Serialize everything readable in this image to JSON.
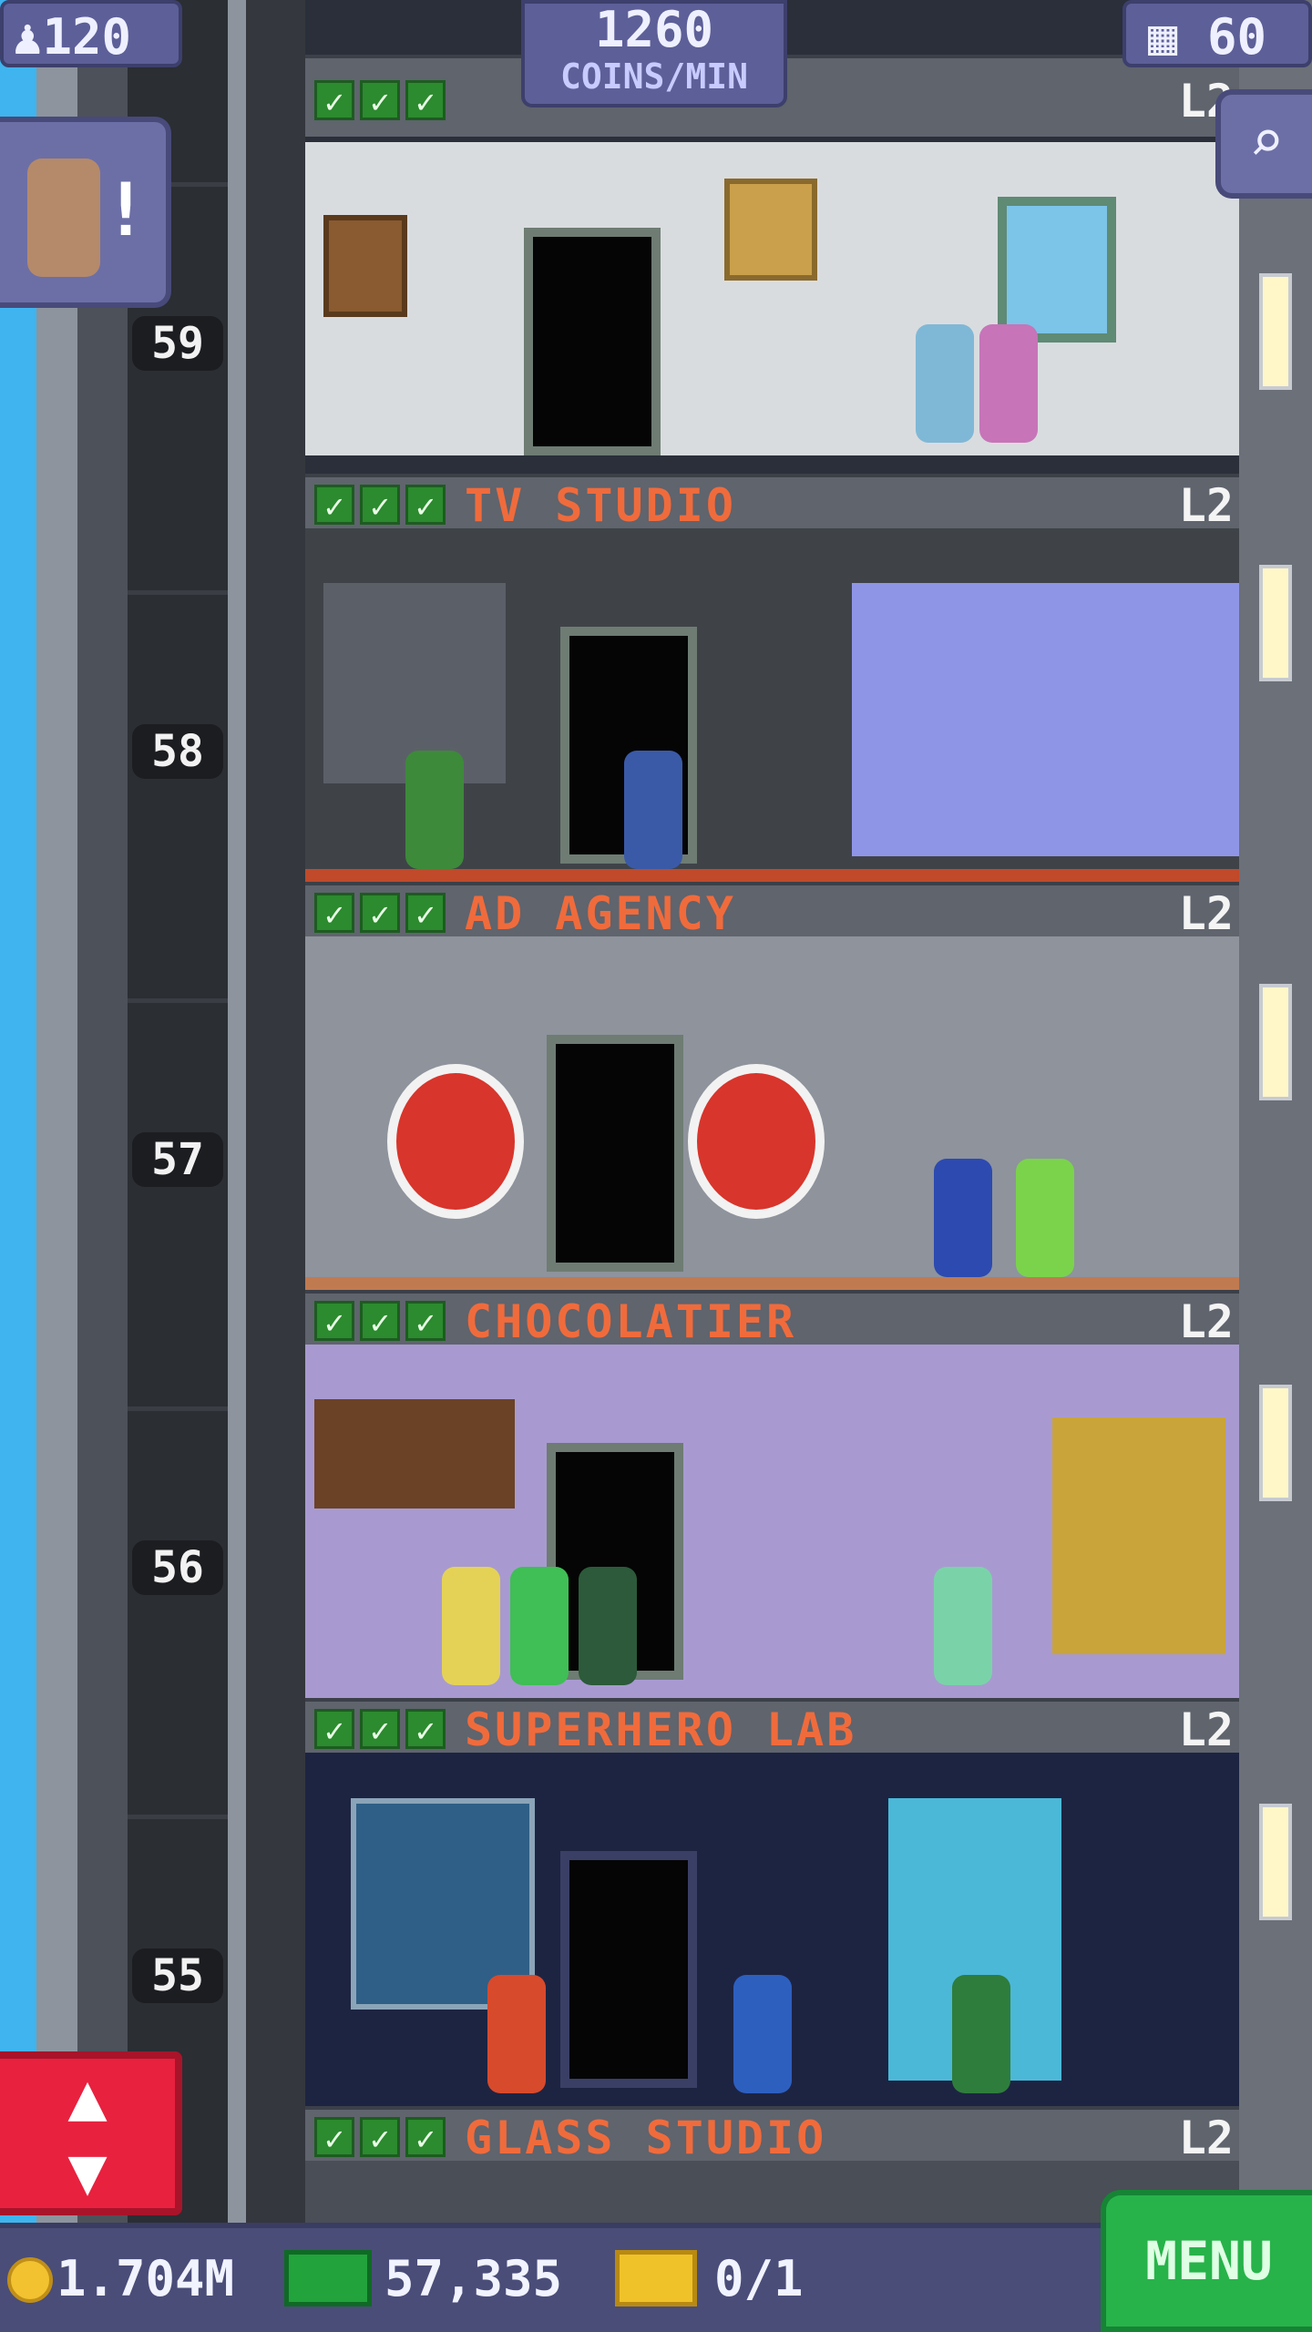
{
  "hud": {
    "population": "120",
    "coins_rate_value": "1260",
    "coins_rate_unit": "COINS/MIN",
    "floors_count": "60"
  },
  "floors": [
    {
      "number": "59",
      "name": "TV STUDIO",
      "level": "L2"
    },
    {
      "number": "58",
      "name": "AD AGENCY",
      "level": "L2"
    },
    {
      "number": "57",
      "name": "CHOCOLATIER",
      "level": "L2"
    },
    {
      "number": "56",
      "name": "SUPERHERO LAB",
      "level": "L2"
    },
    {
      "number": "55",
      "name": "GLASS STUDIO",
      "level": "L2"
    }
  ],
  "top_floor_level": "L2",
  "bottom_bar": {
    "coins": "1.704M",
    "bux": "57,335",
    "tickets": "0/1",
    "menu_label": "MENU"
  },
  "icons": {
    "population": "person-icon",
    "floors": "building-icon",
    "search": "magnifier-icon",
    "elevator": "up-down-arrows-icon",
    "coin": "coin-icon",
    "bux": "bux-bill-icon",
    "ticket": "golden-ticket-icon"
  },
  "colors": {
    "floor_name": "#f06b3c",
    "hud_panel": "#5d5f98",
    "menu_button": "#27b34a",
    "elevator_button": "#e8213f",
    "sky": "#3fb4ee"
  }
}
